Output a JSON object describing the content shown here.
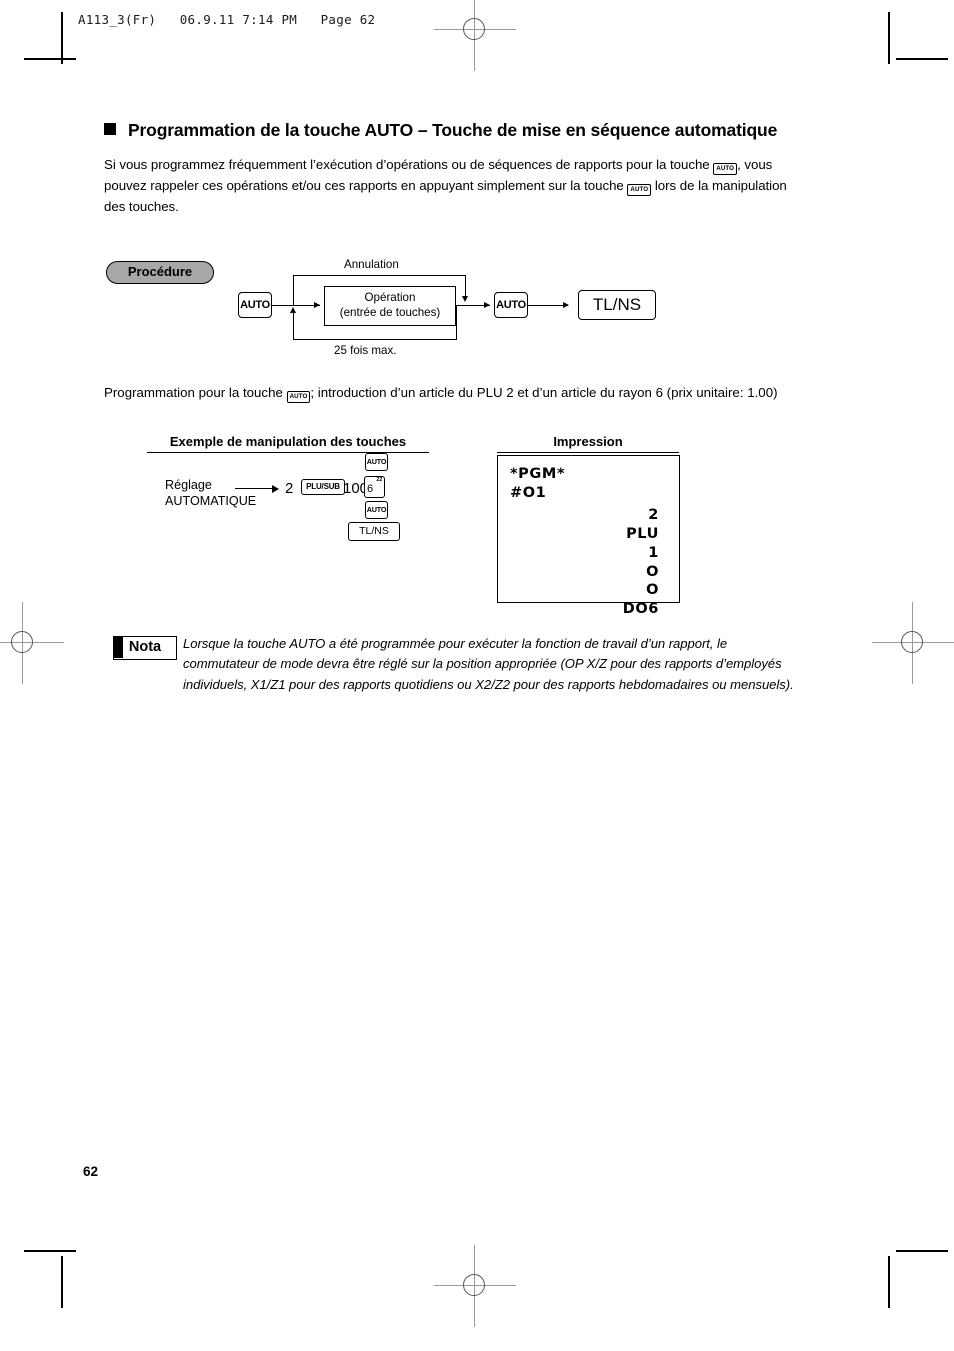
{
  "doc": {
    "running_header": "A113_3(Fr)   06.9.11 7:14 PM   Page 62",
    "page_number": "62"
  },
  "section": {
    "title": "Programmation de la touche AUTO – Touche de mise en séquence automatique",
    "intro_part1": "Si vous programmez fréquemment l’exécution d’opérations ou de séquences de rapports pour la touche ",
    "intro_key1": "AUTO",
    "intro_part2": ", vous pouvez rappeler ces opérations et/ou ces rapports en appuyant simplement sur la touche ",
    "intro_key2": "AUTO",
    "intro_part3": " lors de la manipulation des touches."
  },
  "procedure": {
    "badge_label": "Procédure",
    "cancel_label": "Annulation",
    "repeat_label": "25 fois max.",
    "key_auto_start": "AUTO",
    "operation_line1": "Opération",
    "operation_line2": "(entrée de touches)",
    "key_auto_end": "AUTO",
    "key_tlns": "TL/NS"
  },
  "example_intro": {
    "part1": "Programmation pour la touche ",
    "key": "AUTO",
    "part2": "; introduction d’un article du PLU 2 et d’un article du rayon 6 (prix unitaire: 1.00)"
  },
  "columns": {
    "example_header": "Exemple de manipulation des touches",
    "impression_header": "Impression"
  },
  "key_operation": {
    "label_line1": "Réglage",
    "label_line2": "AUTOMATIQUE",
    "entry_plu_number": "2",
    "key_plusub": "PLU/SUB",
    "entry_price": "100",
    "key_dept_number": "6",
    "key_dept_superscript": "22",
    "key_auto_top": "AUTO",
    "key_auto_bottom": "AUTO",
    "key_tlns": "TL/NS"
  },
  "receipt": {
    "header_line1": "*PGM*",
    "header_line2": "#O1",
    "lines": [
      "2",
      "PLU",
      "1",
      "O",
      "O",
      "DO6"
    ]
  },
  "nota": {
    "label": "Nota",
    "text": "Lorsque la touche AUTO a été programmée pour exécuter la fonction de travail d’un rapport, le commutateur de mode devra être réglé sur la position appropriée (OP X/Z pour des rapports d’employés individuels, X1/Z1 pour des rapports quotidiens ou X2/Z2 pour des rapports hebdomadaires ou mensuels)."
  }
}
